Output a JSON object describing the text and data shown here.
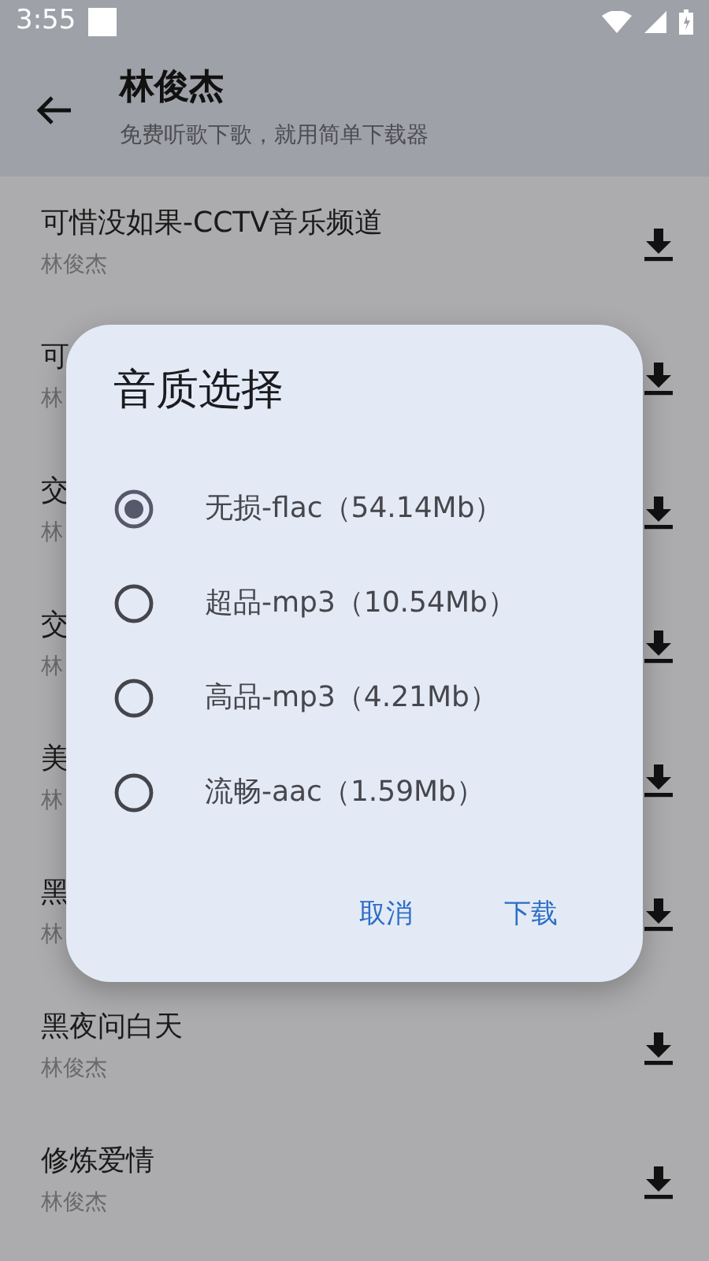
{
  "status_bar": {
    "time": "3:55"
  },
  "app_bar": {
    "title": "林俊杰",
    "subtitle": "免费听歌下歌，就用简单下载器"
  },
  "songs": [
    {
      "title": "可惜没如果-CCTV音乐频道",
      "artist": "林俊杰"
    },
    {
      "title": "可",
      "artist": "林"
    },
    {
      "title": "交",
      "artist": "林"
    },
    {
      "title": "交",
      "artist": "林"
    },
    {
      "title": "美",
      "artist": "林"
    },
    {
      "title": "黑",
      "artist": "林"
    },
    {
      "title": "黑夜问白天",
      "artist": "林俊杰"
    },
    {
      "title": "修炼爱情",
      "artist": "林俊杰"
    }
  ],
  "dialog": {
    "title": "音质选择",
    "options": [
      {
        "label": "无损-flac（54.14Mb）",
        "selected": true
      },
      {
        "label": "超品-mp3（10.54Mb）",
        "selected": false
      },
      {
        "label": "高品-mp3（4.21Mb）",
        "selected": false
      },
      {
        "label": "流畅-aac（1.59Mb）",
        "selected": false
      }
    ],
    "buttons": [
      "取消",
      "下载"
    ]
  }
}
